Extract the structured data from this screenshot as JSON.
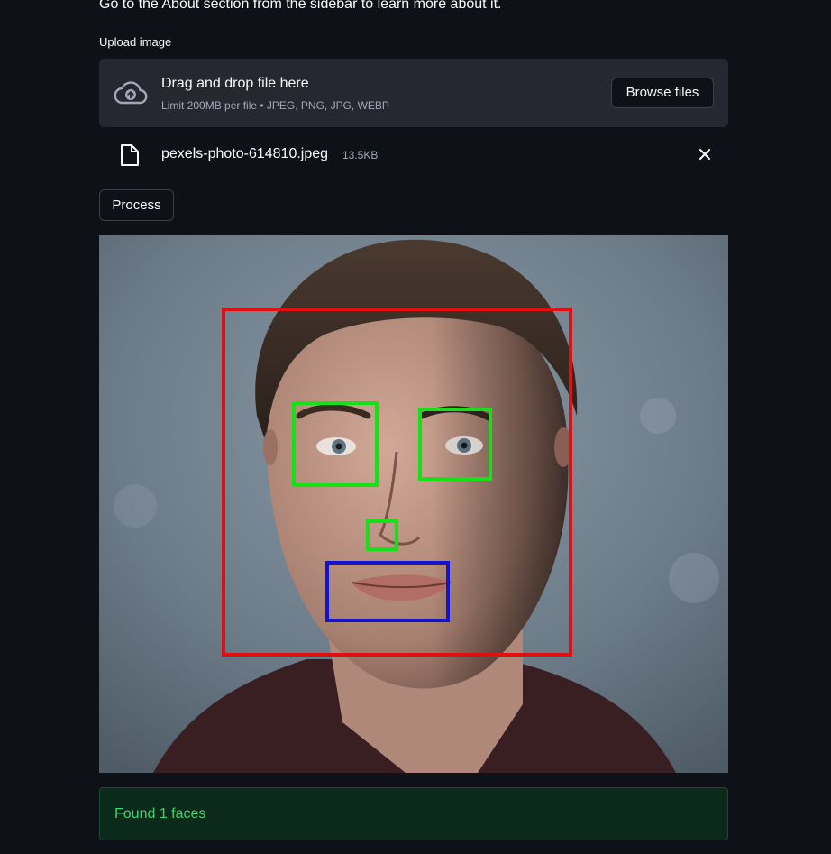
{
  "intro_text": "Go to the About section from the sidebar to learn more about it.",
  "uploader": {
    "label": "Upload image",
    "title": "Drag and drop file here",
    "limit": "Limit 200MB per file • JPEG, PNG, JPG, WEBP",
    "browse_label": "Browse files",
    "upload_icon": "cloud-upload-icon"
  },
  "file": {
    "name": "pexels-photo-614810.jpeg",
    "size": "13.5KB",
    "file_icon": "file-icon",
    "remove_icon": "close-icon"
  },
  "process_label": "Process",
  "colors": {
    "face_box": "#e01010",
    "eye_box": "#18e018",
    "mouth_box": "#1414d0",
    "success_text": "#3dd56d",
    "success_bg": "#0b2a1c"
  },
  "result": {
    "message": "Found 1 faces"
  }
}
